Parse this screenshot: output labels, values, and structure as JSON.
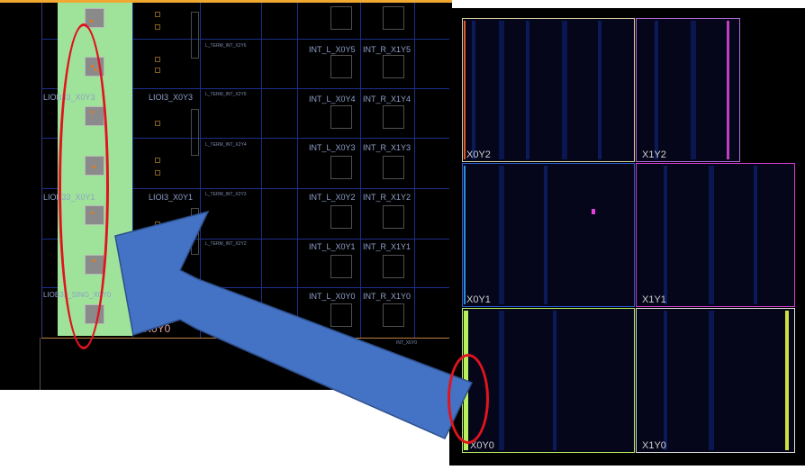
{
  "left_view": {
    "site_labels": [
      "LIOB33_X0Y3",
      "LIOB33_X0Y1",
      "LIOB33_SING_X0Y0"
    ],
    "ioi_labels": [
      "LIOI3_X0Y3",
      "LIOI3_X0Y1"
    ],
    "term_labels": [
      "L_TERM_INT_X2Y6",
      "L_TERM_INT_X2Y5",
      "L_TERM_INT_X2Y4",
      "L_TERM_INT_X2Y3",
      "L_TERM_INT_X2Y2"
    ],
    "int_l_labels": [
      "INT_L_X0Y5",
      "INT_L_X0Y4",
      "INT_L_X0Y3",
      "INT_L_X0Y2",
      "INT_L_X0Y1",
      "INT_L_X0Y0"
    ],
    "int_r_labels": [
      "INT_R_X1Y5",
      "INT_R_X1Y4",
      "INT_R_X1Y3",
      "INT_R_X1Y2",
      "INT_R_X1Y1",
      "INT_R_X1Y0"
    ],
    "clock_region_label": "X0Y0",
    "bottom_small_label": "INT_X6Y0"
  },
  "right_view": {
    "regions": [
      {
        "label": "X0Y2",
        "border": "#d8d2a0"
      },
      {
        "label": "X1Y2",
        "border": "#b06cd8"
      },
      {
        "label": "X0Y1",
        "border": "#2a5fd8"
      },
      {
        "label": "X1Y1",
        "border": "#d23cd2"
      },
      {
        "label": "X0Y0",
        "border": "#b8f060"
      },
      {
        "label": "X1Y0",
        "border": "#ffffff"
      }
    ]
  },
  "colors": {
    "io_column": "#9fe39a",
    "arrow": "#4472c4",
    "highlight_ellipse": "#e0141e",
    "top_rule": "#f0a830"
  }
}
